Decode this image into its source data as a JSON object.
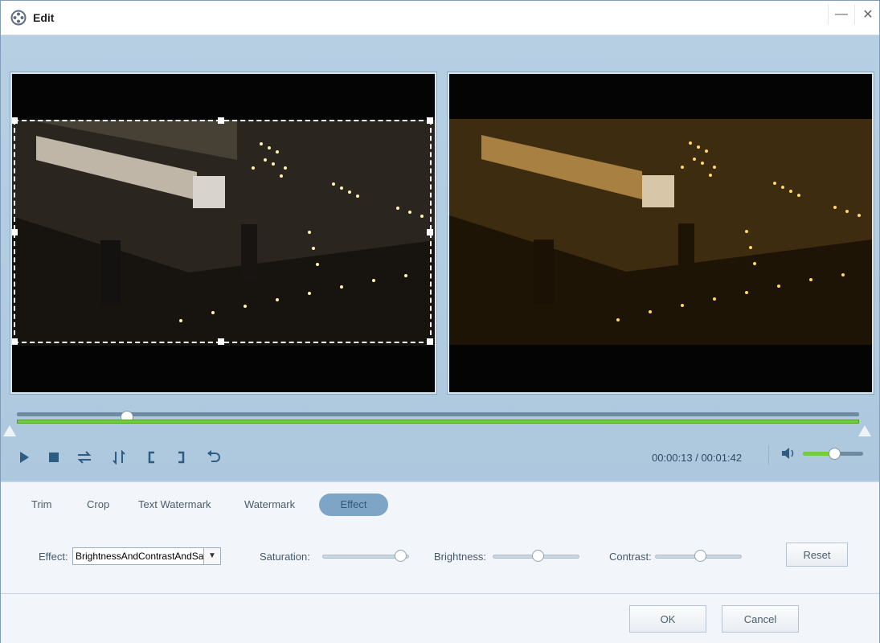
{
  "window": {
    "title": "Edit",
    "minimize_glyph": "—",
    "close_glyph": "✕"
  },
  "playback": {
    "time_display": "00:00:13 / 00:01:42",
    "seek_fraction": 0.13,
    "trim_start_fraction": 0.0,
    "trim_end_fraction": 1.0,
    "volume_fraction": 0.5,
    "controls": [
      "play-icon",
      "stop-icon",
      "swap-icon",
      "flip-icon",
      "mark-in-icon",
      "mark-out-icon",
      "undo-icon"
    ]
  },
  "tabs": [
    {
      "label": "Trim",
      "active": false
    },
    {
      "label": "Crop",
      "active": false
    },
    {
      "label": "Text Watermark",
      "active": false
    },
    {
      "label": "Watermark",
      "active": false
    },
    {
      "label": "Effect",
      "active": true
    }
  ],
  "effect_panel": {
    "effect_label": "Effect:",
    "effect_value": "BrightnessAndContrastAndSa",
    "saturation_label": "Saturation:",
    "saturation_fraction": 0.88,
    "brightness_label": "Brightness:",
    "brightness_fraction": 0.5,
    "contrast_label": "Contrast:",
    "contrast_fraction": 0.5,
    "reset_label": "Reset"
  },
  "footer": {
    "ok_label": "OK",
    "cancel_label": "Cancel"
  },
  "colors": {
    "accent": "#6fcf3e",
    "active_tab": "#7ea5c6",
    "background": "#b9d2e6"
  }
}
